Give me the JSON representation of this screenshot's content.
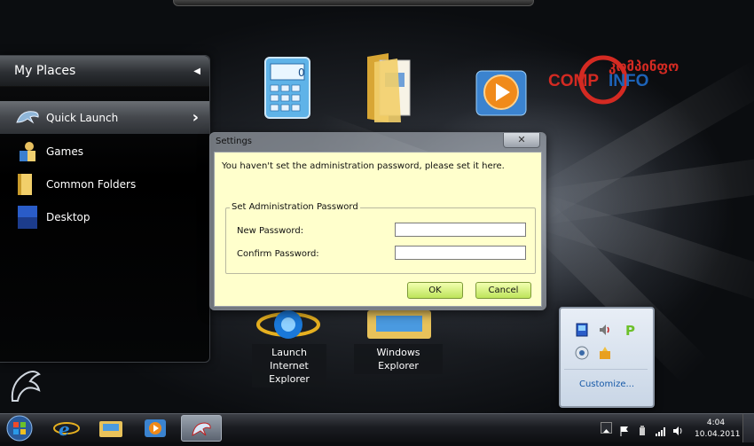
{
  "places": {
    "title": "My Places",
    "items": [
      {
        "label": "Quick Launch",
        "active": true
      },
      {
        "label": "Games"
      },
      {
        "label": "Common Folders"
      },
      {
        "label": "Desktop"
      }
    ]
  },
  "desktop_icons": [
    {
      "name": "calculator",
      "caption": "Calculator"
    },
    {
      "name": "documents",
      "caption": "My Documents"
    },
    {
      "name": "media-player",
      "caption": "Windows Media Player"
    },
    {
      "name": "internet-explorer",
      "caption": "Launch Internet Explorer"
    },
    {
      "name": "windows-explorer",
      "caption": "Windows Explorer"
    }
  ],
  "ie_caption_line1": "Launch Internet",
  "ie_caption_line2": "Explorer",
  "logo": {
    "text_left": "COMP",
    "text_right": "INFO",
    "text_top": "კომპინფო",
    "color": "#d42a22",
    "color_blue": "#1d63b8"
  },
  "dialog": {
    "title": "Settings",
    "close": "✕",
    "message": "You haven't set the administration password, please set it here.",
    "group_label": "Set Administration Password",
    "new_password_label": "New Password:",
    "confirm_password_label": "Confirm Password:",
    "new_password_value": "",
    "confirm_password_value": "",
    "ok_label": "OK",
    "cancel_label": "Cancel"
  },
  "tray_popup": {
    "customize": "Customize..."
  },
  "clock": {
    "time": "4:04",
    "date": "10.04.2011"
  }
}
